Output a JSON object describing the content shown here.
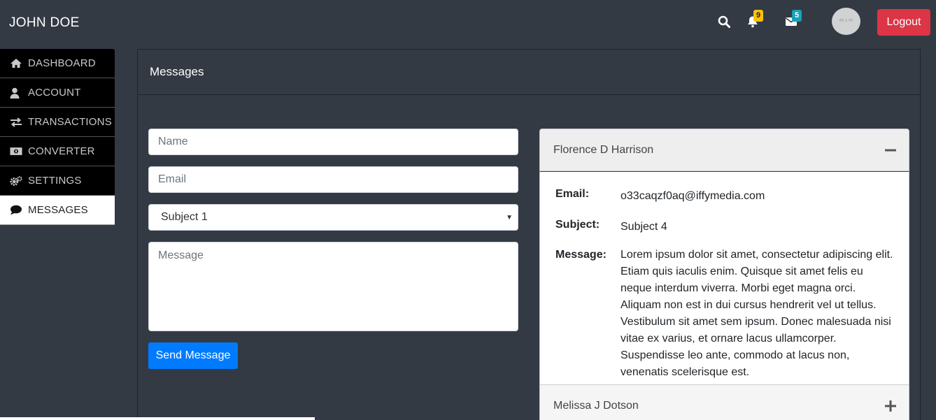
{
  "header": {
    "brand": "JOHN DOE",
    "notifications_count": "9",
    "messages_count": "5",
    "avatar_label": "40 x 40",
    "logout_label": "Logout"
  },
  "sidebar": {
    "items": [
      {
        "label": "DASHBOARD",
        "icon": "home-icon"
      },
      {
        "label": "ACCOUNT",
        "icon": "user-icon"
      },
      {
        "label": "TRANSACTIONS",
        "icon": "exchange-icon"
      },
      {
        "label": "CONVERTER",
        "icon": "money-icon"
      },
      {
        "label": "SETTINGS",
        "icon": "cogs-icon"
      },
      {
        "label": "MESSAGES",
        "icon": "comment-icon",
        "active": true
      }
    ]
  },
  "main": {
    "title": "Messages",
    "form": {
      "name_placeholder": "Name",
      "email_placeholder": "Email",
      "subject_selected": "Subject 1",
      "message_placeholder": "Message",
      "send_label": "Send Message"
    },
    "messages": [
      {
        "sender": "Florence D Harrison",
        "expanded": true,
        "email_label": "Email:",
        "email": "o33caqzf0aq@iffymedia.com",
        "subject_label": "Subject:",
        "subject": "Subject 4",
        "message_label": "Message:",
        "message": "Lorem ipsum dolor sit amet, consectetur adipiscing elit. Etiam quis iaculis enim. Quisque sit amet felis eu neque interdum viverra. Morbi eget magna orci. Aliquam non est in dui cursus hendrerit vel ut tellus. Vestibulum sit amet sem ipsum. Donec malesuada nisi vitae ex varius, et ornare lacus ullamcorper. Suspendisse leo ante, commodo at lacus non, venenatis scelerisque est."
      },
      {
        "sender": "Melissa J Dotson",
        "expanded": false
      }
    ]
  },
  "colors": {
    "background": "#343a44",
    "logout": "#dc3545",
    "primary": "#007bff",
    "badge_yellow": "#ffc107",
    "badge_teal": "#17a2b8"
  }
}
